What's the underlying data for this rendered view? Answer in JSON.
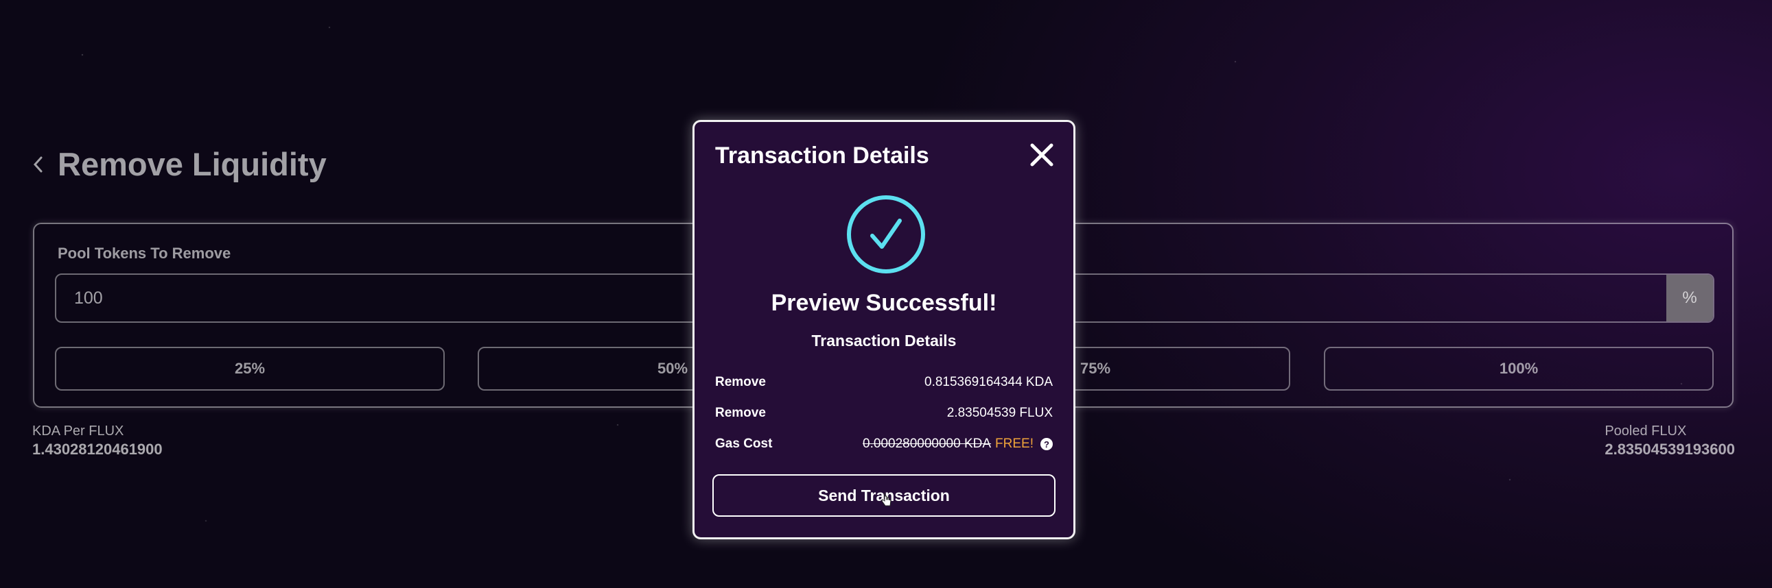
{
  "page": {
    "title": "Remove Liquidity",
    "pool_label": "Pool Tokens To Remove",
    "amount_value": "100",
    "amount_suffix": "%",
    "percent_buttons": [
      "25%",
      "50%",
      "75%",
      "100%"
    ],
    "stats": {
      "left": {
        "label": "KDA Per FLUX",
        "value": "1.43028120461900"
      },
      "right": {
        "label": "Pooled FLUX",
        "value": "2.83504539193600"
      }
    }
  },
  "modal": {
    "title": "Transaction Details",
    "preview_title": "Preview Successful!",
    "subtitle": "Transaction Details",
    "rows": [
      {
        "label": "Remove",
        "value": "0.815369164344 KDA"
      },
      {
        "label": "Remove",
        "value": "2.83504539 FLUX"
      }
    ],
    "gas": {
      "label": "Gas Cost",
      "amount": "0.000280000000 KDA",
      "free": "FREE!",
      "help": "?"
    },
    "send_label": "Send Transaction"
  },
  "icons": {
    "back": "chevron-left-icon",
    "close": "close-icon",
    "success": "check-circle-icon",
    "help": "help-icon",
    "cursor": "cursor-icon"
  },
  "colors": {
    "modal_bg": "#250d37",
    "success_ring": "#5ce0f0",
    "free": "#f0a43a"
  }
}
